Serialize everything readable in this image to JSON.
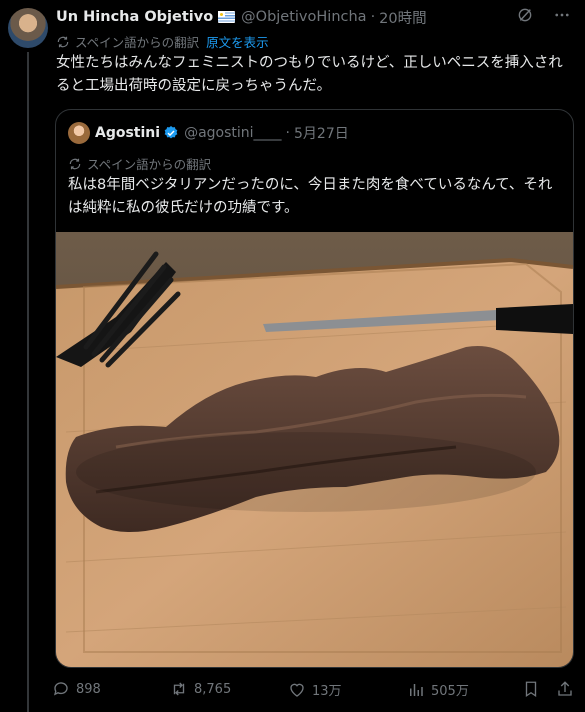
{
  "post": {
    "display_name": "Un Hincha Objetivo",
    "handle": "@ObjetivoHincha",
    "separator": "·",
    "time": "20時間",
    "translated_from": "スペイン語からの翻訳",
    "show_original": "原文を表示",
    "text": "女性たちはみんなフェミニストのつもりでいるけど、正しいペニスを挿入されると工場出荷時の設定に戻っちゃうんだ。"
  },
  "quote": {
    "display_name": "Agostini",
    "handle": "@agostini____",
    "separator": "·",
    "date": "5月27日",
    "translated_from": "スペイン語からの翻訳",
    "text": "私は8年間ベジタリアンだったのに、今日また肉を食べているなんて、それは純粋に私の彼氏だけの功績です。"
  },
  "actions": {
    "replies": "898",
    "reposts": "8,765",
    "likes": "13万",
    "views": "505万"
  },
  "colors": {
    "background": "#000000",
    "text": "#e7e9ea",
    "muted": "#71767b",
    "link": "#1d9bf0",
    "border": "#2f3336"
  }
}
